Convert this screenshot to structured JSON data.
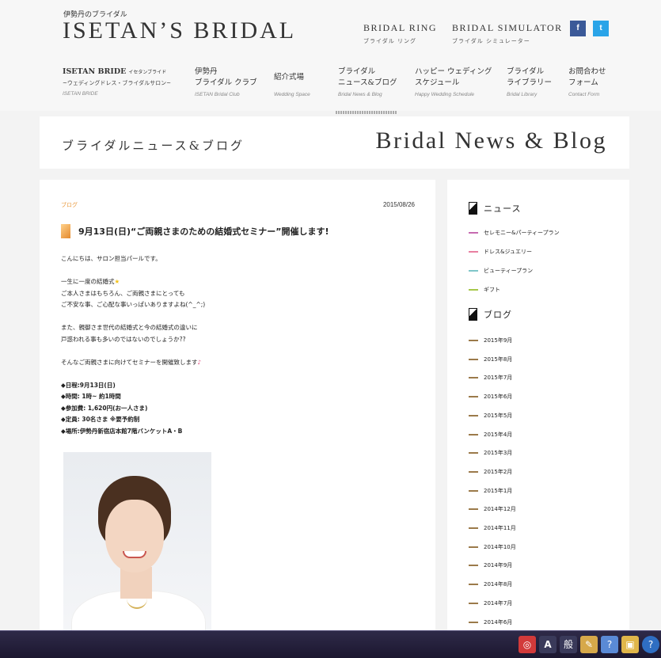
{
  "header": {
    "logo_sub": "伊勢丹のブライダル",
    "logo": "ISETAN’S BRIDAL",
    "links": [
      {
        "en": "BRIDAL RING",
        "jp": "ブライダル リング"
      },
      {
        "en": "BRIDAL SIMULATOR",
        "jp": "ブライダル シミュレーター"
      }
    ],
    "sns": {
      "facebook": "f",
      "twitter": "t"
    }
  },
  "gnav": [
    {
      "l1": "ISETAN BRIDE",
      "l1_small": "イセタンブライド",
      "l2": "~ウェディングドレス・ブライダルサロン~",
      "en": "ISETAN BRIDE"
    },
    {
      "l1": "伊勢丹",
      "l2": "ブライダル クラブ",
      "en": "ISETAN Bridal Club"
    },
    {
      "l1": "紹介式場",
      "l2": "",
      "en": "Wedding Space"
    },
    {
      "l1": "ブライダル",
      "l2": "ニュース&ブログ",
      "en": "Bridal News & Blog"
    },
    {
      "l1": "ハッピー ウェディング",
      "l2": "スケジュール",
      "en": "Happy Wedding Schedule"
    },
    {
      "l1": "ブライダル",
      "l2": "ライブラリー",
      "en": "Bridal Library"
    },
    {
      "l1": "お問合わせ",
      "l2": "フォーム",
      "en": "Contact Form"
    }
  ],
  "title_band": {
    "jp": "ブライダルニュース&ブログ",
    "en": "Bridal News & Blog"
  },
  "post": {
    "category": "ブログ",
    "date": "2015/08/26",
    "title": "9月13日(日)“ご両親さまのための結婚式セミナー”開催します!",
    "lines": [
      "こんにちは、サロン担当パールです。",
      "",
      "一生に一度の結婚式",
      "ご本人さまはもちろん、ご両親さまにとっても",
      "ご不安な事、ご心配な事いっぱいありますよね(^_^;)",
      "",
      "また、親御さま世代の結婚式と今の結婚式の違いに",
      "戸惑われる事も多いのではないのでしょうか??",
      "",
      "そんなご両親さまに向けてセミナーを開催致します"
    ],
    "details": [
      "◆日程:9月13日(日)",
      "◆時間: 1時~ 約1時間",
      "◆参加費: 1,620円(お一人さま)",
      "◆定員: 30名さま ※要予約制",
      "◆場所:伊勢丹新宿店本館7階バンケットA・B"
    ],
    "emoji_star": "★",
    "emoji_note": "♪"
  },
  "sidebar": {
    "news_heading": "ニュース",
    "news": [
      {
        "label": "セレモニー&パーティープラン",
        "color": "#c66ab0"
      },
      {
        "label": "ドレス&ジュエリー",
        "color": "#e87fa1"
      },
      {
        "label": "ビューティープラン",
        "color": "#7fc6c9"
      },
      {
        "label": "ギフト",
        "color": "#a6c84a"
      }
    ],
    "blog_heading": "ブログ",
    "blog": [
      "2015年9月",
      "2015年8月",
      "2015年7月",
      "2015年6月",
      "2015年5月",
      "2015年4月",
      "2015年3月",
      "2015年2月",
      "2015年1月",
      "2014年12月",
      "2014年11月",
      "2014年10月",
      "2014年9月",
      "2014年8月",
      "2014年7月",
      "2014年6月"
    ],
    "blog_color": "#9b7a4a"
  },
  "taskbar": {
    "tray": [
      "A",
      "般"
    ]
  }
}
